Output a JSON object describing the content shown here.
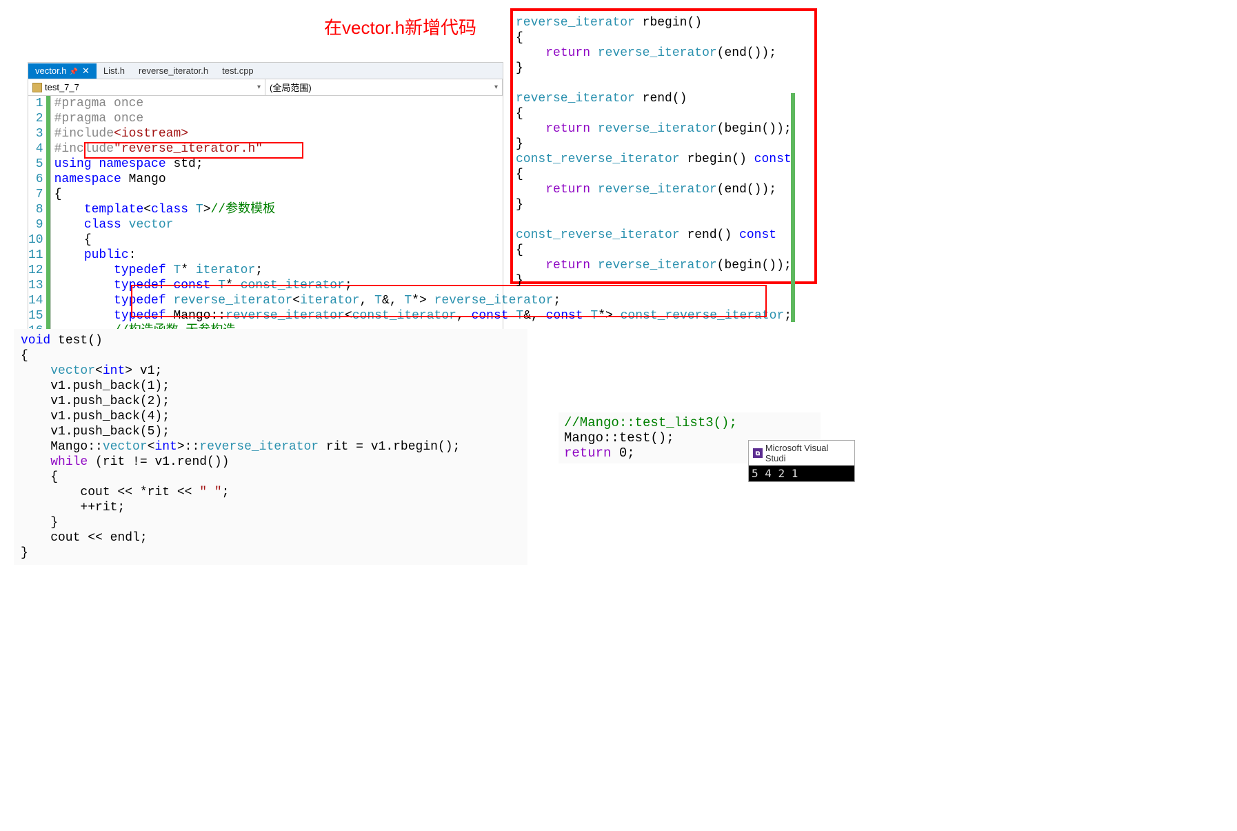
{
  "annotation": "在vector.h新增代码",
  "tabs": {
    "active": "vector.h",
    "others": [
      "List.h",
      "reverse_iterator.h",
      "test.cpp"
    ]
  },
  "dropdowns": {
    "scope": "test_7_7",
    "context": "(全局范围)"
  },
  "editor_lines": [
    {
      "n": 1,
      "tokens": [
        [
          "c-gray",
          "#pragma once"
        ]
      ]
    },
    {
      "n": 2,
      "tokens": [
        [
          "c-gray",
          "#pragma once"
        ]
      ]
    },
    {
      "n": 3,
      "tokens": [
        [
          "c-gray",
          "#include"
        ],
        [
          "c-str",
          "<iostream>"
        ]
      ]
    },
    {
      "n": 4,
      "tokens": [
        [
          "c-gray",
          "#include"
        ],
        [
          "c-str",
          "\"reverse_iterator.h\""
        ]
      ]
    },
    {
      "n": 5,
      "tokens": [
        [
          "c-kw",
          "using "
        ],
        [
          "c-kw",
          "namespace "
        ],
        [
          "",
          "std;"
        ]
      ]
    },
    {
      "n": 6,
      "tokens": [
        [
          "c-kw",
          "namespace "
        ],
        [
          "",
          "Mango"
        ]
      ]
    },
    {
      "n": 7,
      "tokens": [
        [
          "",
          "{"
        ]
      ]
    },
    {
      "n": 8,
      "tokens": [
        [
          "",
          "    "
        ],
        [
          "c-kw",
          "template"
        ],
        [
          "",
          "<"
        ],
        [
          "c-kw",
          "class "
        ],
        [
          "c-type",
          "T"
        ],
        [
          "",
          ">"
        ],
        [
          "c-green",
          "//参数模板"
        ]
      ]
    },
    {
      "n": 9,
      "tokens": [
        [
          "",
          "    "
        ],
        [
          "c-kw",
          "class "
        ],
        [
          "c-type",
          "vector"
        ]
      ]
    },
    {
      "n": 10,
      "tokens": [
        [
          "",
          "    {"
        ]
      ]
    },
    {
      "n": 11,
      "tokens": [
        [
          "",
          "    "
        ],
        [
          "c-kw",
          "public"
        ],
        [
          "",
          ":"
        ]
      ]
    },
    {
      "n": 12,
      "tokens": [
        [
          "",
          "        "
        ],
        [
          "c-kw",
          "typedef "
        ],
        [
          "c-type",
          "T"
        ],
        [
          "",
          "* "
        ],
        [
          "c-type",
          "iterator"
        ],
        [
          "",
          ";"
        ]
      ]
    },
    {
      "n": 13,
      "tokens": [
        [
          "",
          "        "
        ],
        [
          "c-kw",
          "typedef "
        ],
        [
          "c-kw",
          "const "
        ],
        [
          "c-type",
          "T"
        ],
        [
          "",
          "* "
        ],
        [
          "c-type",
          "const_iterator"
        ],
        [
          "",
          ";"
        ]
      ]
    },
    {
      "n": 14,
      "tokens": [
        [
          "",
          "        "
        ],
        [
          "c-kw",
          "typedef "
        ],
        [
          "c-type",
          "reverse_iterator"
        ],
        [
          "",
          "<"
        ],
        [
          "c-type",
          "iterator"
        ],
        [
          "",
          ", "
        ],
        [
          "c-type",
          "T"
        ],
        [
          "",
          "&, "
        ],
        [
          "c-type",
          "T"
        ],
        [
          "",
          "*> "
        ],
        [
          "c-type",
          "reverse_iterator"
        ],
        [
          "",
          ";"
        ]
      ]
    },
    {
      "n": 15,
      "tokens": [
        [
          "",
          "        "
        ],
        [
          "c-kw",
          "typedef "
        ],
        [
          "",
          "Mango::"
        ],
        [
          "c-type",
          "reverse_iterator"
        ],
        [
          "",
          "<"
        ],
        [
          "c-type",
          "const_iterator"
        ],
        [
          "",
          ", "
        ],
        [
          "c-kw",
          "const "
        ],
        [
          "c-type",
          "T"
        ],
        [
          "",
          "&, "
        ],
        [
          "c-kw",
          "const "
        ],
        [
          "c-type",
          "T"
        ],
        [
          "",
          "*> "
        ],
        [
          "c-type",
          "const_reverse_iterator"
        ],
        [
          "",
          ";"
        ]
      ]
    },
    {
      "n": 16,
      "tokens": [
        [
          "",
          "        "
        ],
        [
          "c-green",
          "//构造函数 无参构造"
        ]
      ]
    }
  ],
  "right_code": [
    [
      [
        "c-type",
        "reverse_iterator "
      ],
      [
        "",
        "rbegin()"
      ]
    ],
    [
      [
        "",
        "{"
      ]
    ],
    [
      [
        "",
        "    "
      ],
      [
        "c-purple",
        "return "
      ],
      [
        "c-type",
        "reverse_iterator"
      ],
      [
        "",
        "(end());"
      ]
    ],
    [
      [
        "",
        "}"
      ]
    ],
    [
      [
        "",
        ""
      ]
    ],
    [
      [
        "c-type",
        "reverse_iterator "
      ],
      [
        "",
        "rend()"
      ]
    ],
    [
      [
        "",
        "{"
      ]
    ],
    [
      [
        "",
        "    "
      ],
      [
        "c-purple",
        "return "
      ],
      [
        "c-type",
        "reverse_iterator"
      ],
      [
        "",
        "(begin());"
      ]
    ],
    [
      [
        "",
        "}"
      ]
    ],
    [
      [
        "c-type",
        "const_reverse_iterator "
      ],
      [
        "",
        "rbegin() "
      ],
      [
        "c-kw",
        "const"
      ]
    ],
    [
      [
        "",
        "{"
      ]
    ],
    [
      [
        "",
        "    "
      ],
      [
        "c-purple",
        "return "
      ],
      [
        "c-type",
        "reverse_iterator"
      ],
      [
        "",
        "(end());"
      ]
    ],
    [
      [
        "",
        "}"
      ]
    ],
    [
      [
        "",
        ""
      ]
    ],
    [
      [
        "c-type",
        "const_reverse_iterator "
      ],
      [
        "",
        "rend() "
      ],
      [
        "c-kw",
        "const"
      ]
    ],
    [
      [
        "",
        "{"
      ]
    ],
    [
      [
        "",
        "    "
      ],
      [
        "c-purple",
        "return "
      ],
      [
        "c-type",
        "reverse_iterator"
      ],
      [
        "",
        "(begin());"
      ]
    ],
    [
      [
        "",
        "}"
      ]
    ]
  ],
  "test_code": [
    [
      [
        "c-kw",
        "void "
      ],
      [
        "",
        "test()"
      ]
    ],
    [
      [
        "",
        "{"
      ]
    ],
    [
      [
        "",
        "    "
      ],
      [
        "c-type",
        "vector"
      ],
      [
        "",
        "<"
      ],
      [
        "c-kw",
        "int"
      ],
      [
        "",
        "> v1;"
      ]
    ],
    [
      [
        "",
        "    v1.push_back(1);"
      ]
    ],
    [
      [
        "",
        "    v1.push_back(2);"
      ]
    ],
    [
      [
        "",
        "    v1.push_back(4);"
      ]
    ],
    [
      [
        "",
        "    v1.push_back(5);"
      ]
    ],
    [
      [
        "",
        "    Mango::"
      ],
      [
        "c-type",
        "vector"
      ],
      [
        "",
        "<"
      ],
      [
        "c-kw",
        "int"
      ],
      [
        "",
        ">::"
      ],
      [
        "c-type",
        "reverse_iterator "
      ],
      [
        "",
        "rit = v1.rbegin();"
      ]
    ],
    [
      [
        "",
        "    "
      ],
      [
        "c-purple",
        "while "
      ],
      [
        "",
        "(rit != v1.rend())"
      ]
    ],
    [
      [
        "",
        "    {"
      ]
    ],
    [
      [
        "",
        "        cout << *rit << "
      ],
      [
        "c-str",
        "\" \""
      ],
      [
        "",
        ";"
      ]
    ],
    [
      [
        "",
        "        ++rit;"
      ]
    ],
    [
      [
        "",
        "    }"
      ]
    ],
    [
      [
        "",
        "    cout << endl;"
      ]
    ],
    [
      [
        "",
        "}"
      ]
    ]
  ],
  "main_code": [
    [
      [
        "c-green",
        "//Mango::test_list3();"
      ]
    ],
    [
      [
        "",
        "Mango::test();"
      ]
    ],
    [
      [
        "c-purple",
        "return "
      ],
      [
        "",
        "0;"
      ]
    ]
  ],
  "vs_window": {
    "title": "Microsoft Visual Studi",
    "console": "5 4 2 1"
  }
}
